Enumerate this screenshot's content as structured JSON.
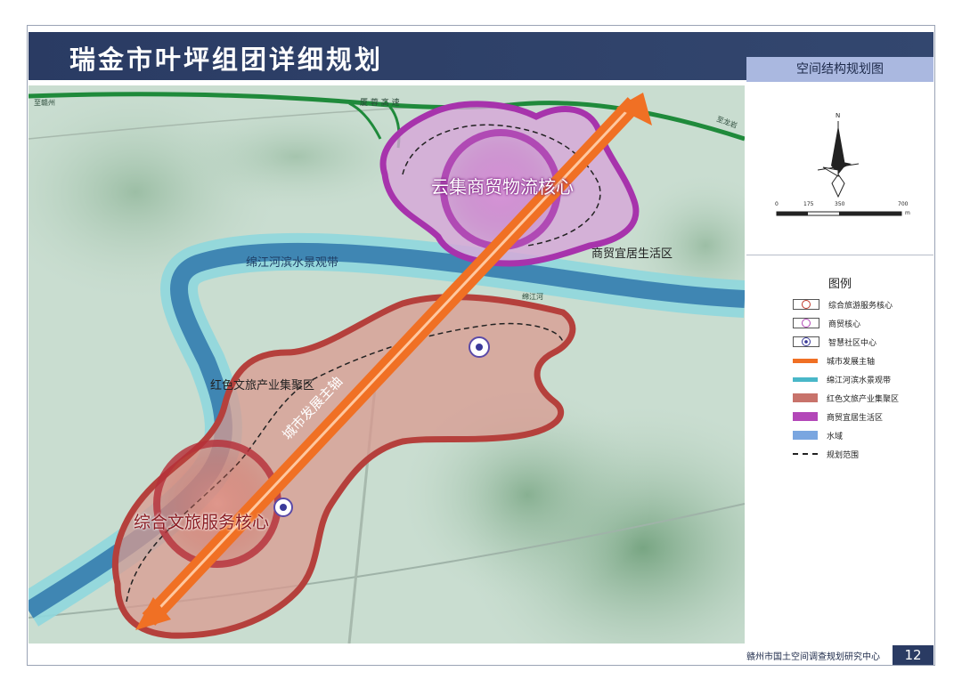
{
  "header": {
    "title": "瑞金市叶坪组团详细规划",
    "subtitle": "空间结构规划图"
  },
  "map": {
    "labels": {
      "core_trade": "云集商贸物流核心",
      "core_tourism": "综合文旅服务核心",
      "living_zone": "商贸宜居生活区",
      "river_band": "绵江河滨水景观带",
      "red_cluster": "红色文旅产业集聚区",
      "main_axis": "城市发展主轴",
      "to_ganzhou": "至赣州",
      "to_longyan": "至龙岩",
      "expressway": "厦 蓉 高 速",
      "river_name": "绵江河"
    },
    "colors": {
      "axis": "#f07024",
      "river": "#4a8fbf",
      "red_zone": "#c8736b",
      "purple_zone": "#b347b8",
      "highway": "#1f8a3b"
    }
  },
  "compass": {
    "north": "N",
    "scale_labels": [
      "0",
      "175",
      "350",
      "700"
    ],
    "unit": "m"
  },
  "legend": {
    "title": "图例",
    "items": [
      {
        "label": "综合旅游服务核心",
        "color": "#c0392b"
      },
      {
        "label": "商贸核心",
        "color": "#b347b8"
      },
      {
        "label": "智慧社区中心",
        "color": "#3a3a9a"
      },
      {
        "label": "城市发展主轴",
        "color": "#f07024"
      },
      {
        "label": "绵江河滨水景观带",
        "color": "#49b7c8"
      },
      {
        "label": "红色文旅产业集聚区",
        "color": "#c8736b"
      },
      {
        "label": "商贸宜居生活区",
        "color": "#b347b8"
      },
      {
        "label": "水域",
        "color": "#7aa6e0"
      },
      {
        "label": "规划范围",
        "color": "#222222"
      }
    ]
  },
  "footer": {
    "org": "赣州市国土空间调查规划研究中心",
    "page": "12"
  }
}
